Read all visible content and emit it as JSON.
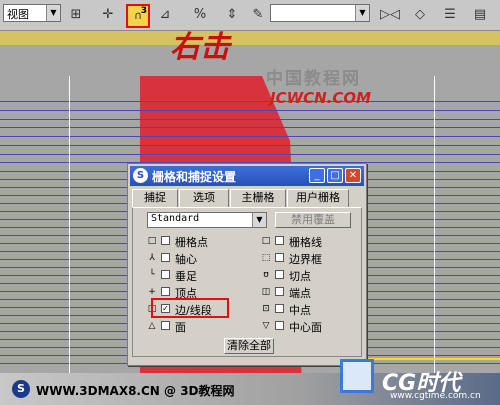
{
  "toolbar": {
    "view_select": "视图",
    "snap_count": "3",
    "named_selection_placeholder": ""
  },
  "annotation": {
    "handwritten": "右击",
    "site_chinese": "中国教程网",
    "site_latin": "JCWCN.COM"
  },
  "dialog": {
    "title": "栅格和捕捉设置",
    "tabs": [
      "捕捉",
      "选项",
      "主栅格",
      "用户栅格"
    ],
    "system_select": "Standard",
    "override_button": "禁用覆盖",
    "left_options": [
      {
        "label": "栅格点",
        "checked": false,
        "icon": "square"
      },
      {
        "label": "轴心",
        "checked": false,
        "icon": "pivot"
      },
      {
        "label": "垂足",
        "checked": false,
        "icon": "perpendicular"
      },
      {
        "label": "顶点",
        "checked": false,
        "icon": "vertex"
      },
      {
        "label": "边/线段",
        "checked": true,
        "icon": "square"
      },
      {
        "label": "面",
        "checked": false,
        "icon": "triangle"
      }
    ],
    "right_options": [
      {
        "label": "栅格线",
        "checked": false,
        "icon": "square"
      },
      {
        "label": "边界框",
        "checked": false,
        "icon": "bbox"
      },
      {
        "label": "切点",
        "checked": false,
        "icon": "tangent"
      },
      {
        "label": "端点",
        "checked": false,
        "icon": "endpoint"
      },
      {
        "label": "中点",
        "checked": false,
        "icon": "midpoint"
      },
      {
        "label": "中心面",
        "checked": false,
        "icon": "center-face"
      }
    ],
    "clear_all_button": "清除全部"
  },
  "footer": {
    "url_text": "WWW.3DMAX8.CN @ 3D教程网",
    "brand": "CG时代",
    "brand_url": "www.cgtime.com.cn"
  }
}
